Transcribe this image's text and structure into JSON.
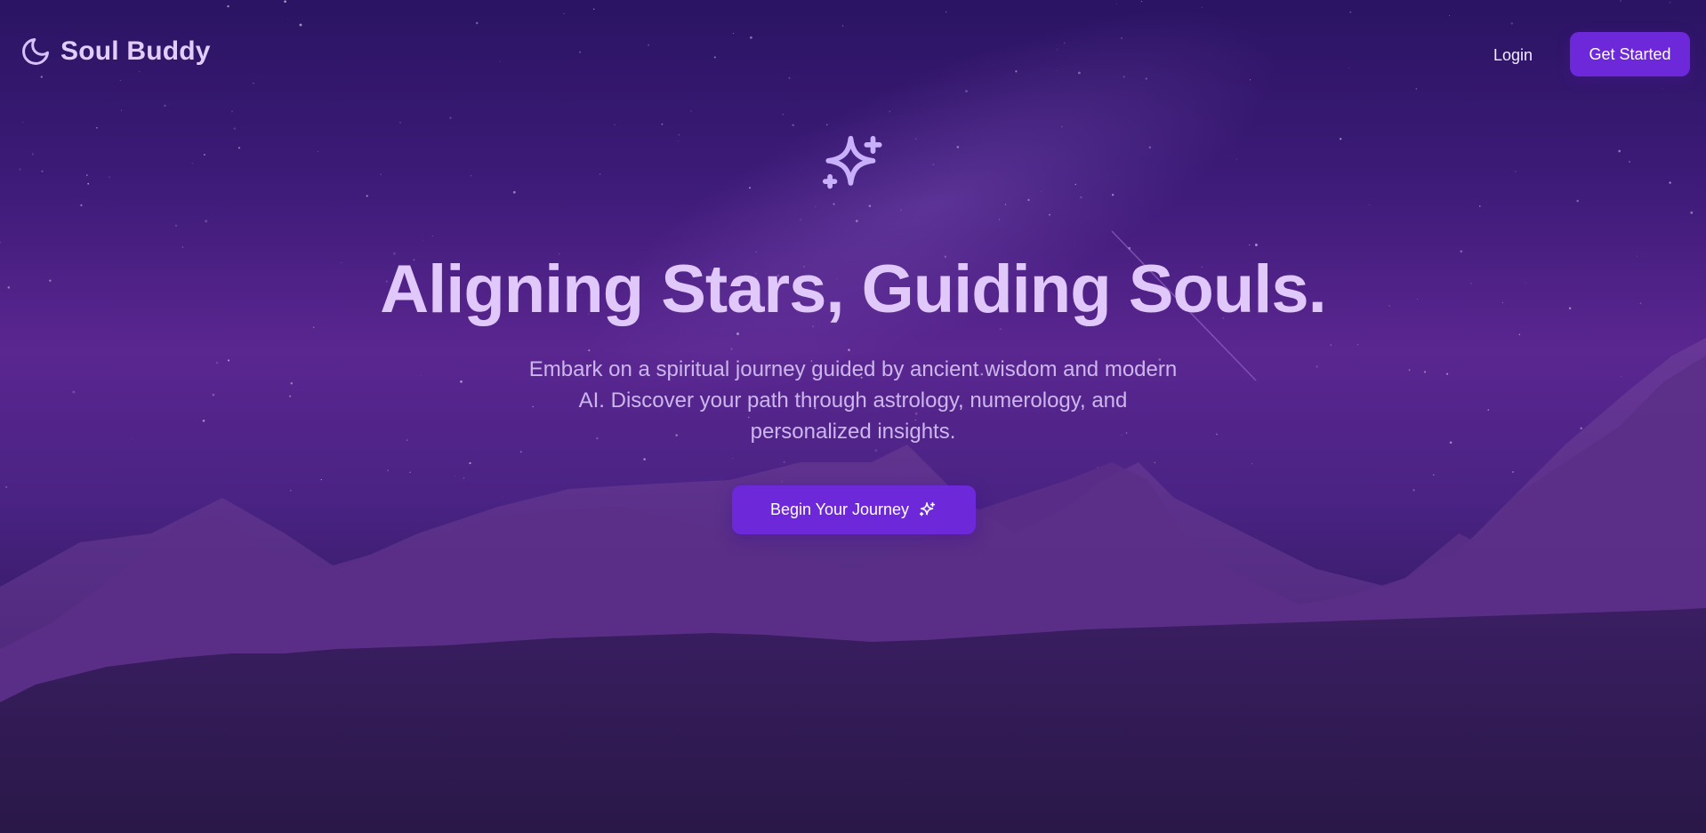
{
  "brand": {
    "name": "Soul Buddy",
    "icon": "moon-icon"
  },
  "nav": {
    "login_label": "Login",
    "get_started_label": "Get Started"
  },
  "hero": {
    "icon": "sparkles-icon",
    "title": "Aligning Stars, Guiding Souls.",
    "subtitle_line1": "Embark on a spiritual journey guided by ancient wisdom and modern",
    "subtitle_line2": "AI. Discover your path through astrology, numerology, and",
    "subtitle_line3": "personalized insights.",
    "cta_label": "Begin Your Journey",
    "cta_icon": "sparkles-icon"
  },
  "colors": {
    "accent": "#6d28d9",
    "title": "#e0c8fb",
    "subtitle": "#cdb6ee",
    "background_top": "#2b1463",
    "background_mid": "#5a2690",
    "background_bottom": "#261544"
  }
}
